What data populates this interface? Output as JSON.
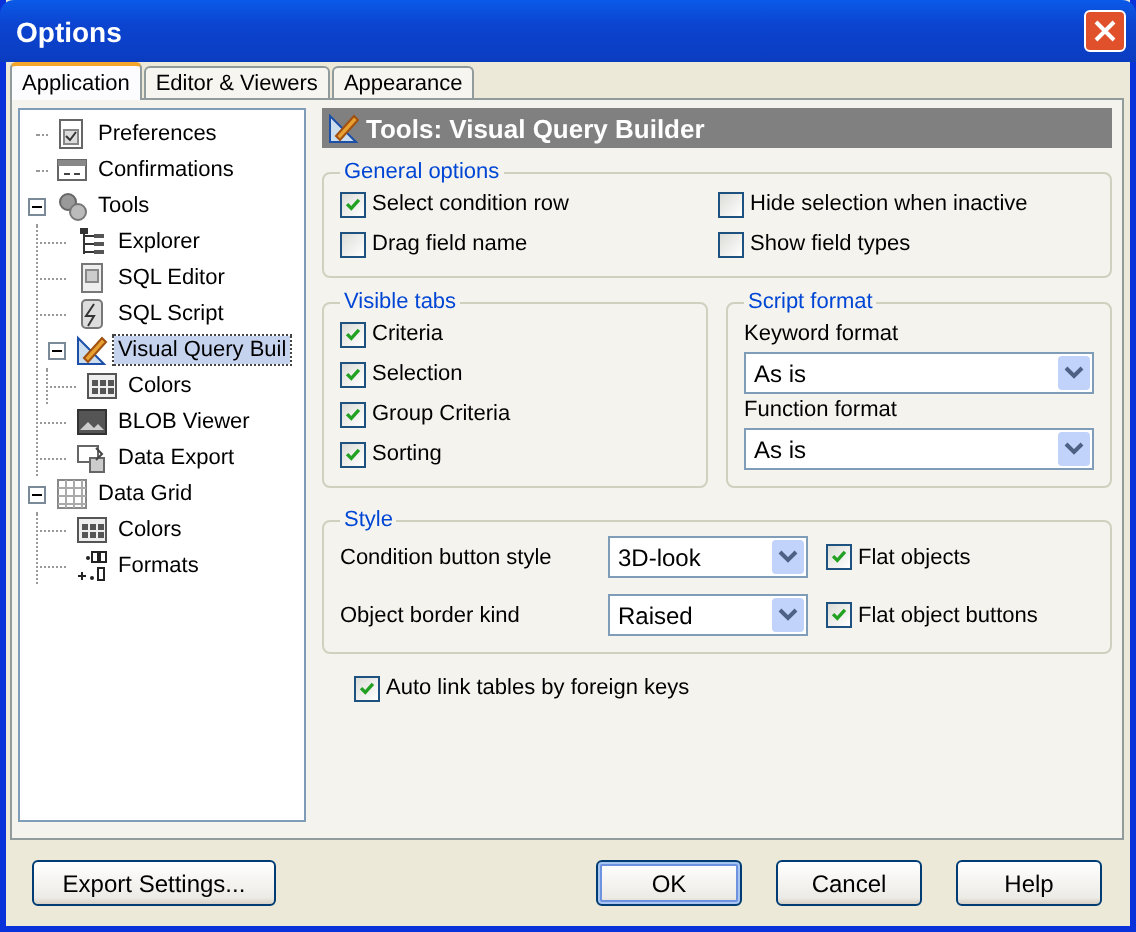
{
  "window": {
    "title": "Options"
  },
  "tabs": [
    {
      "label": "Application",
      "selected": true
    },
    {
      "label": "Editor & Viewers",
      "selected": false
    },
    {
      "label": "Appearance",
      "selected": false
    }
  ],
  "tree": [
    {
      "label": "Preferences",
      "selected": false
    },
    {
      "label": "Confirmations",
      "selected": false
    },
    {
      "label": "Tools",
      "selected": false,
      "expanded": true,
      "children": [
        {
          "label": "Explorer",
          "selected": false
        },
        {
          "label": "SQL Editor",
          "selected": false
        },
        {
          "label": "SQL Script",
          "selected": false
        },
        {
          "label": "Visual Query Buil",
          "selected": true,
          "expanded": true,
          "children": [
            {
              "label": "Colors",
              "selected": false
            }
          ]
        },
        {
          "label": "BLOB Viewer",
          "selected": false
        },
        {
          "label": "Data Export",
          "selected": false
        }
      ]
    },
    {
      "label": "Data Grid",
      "selected": false,
      "expanded": true,
      "children": [
        {
          "label": "Colors",
          "selected": false
        },
        {
          "label": "Formats",
          "selected": false
        }
      ]
    }
  ],
  "panel": {
    "title": "Tools: Visual Query Builder",
    "general_options": {
      "title": "General options",
      "checkboxes": [
        {
          "label": "Select condition row",
          "checked": true
        },
        {
          "label": "Hide selection when inactive",
          "checked": false
        },
        {
          "label": "Drag field name",
          "checked": false
        },
        {
          "label": "Show field types",
          "checked": false
        }
      ]
    },
    "visible_tabs": {
      "title": "Visible tabs",
      "checkboxes": [
        {
          "label": "Criteria",
          "checked": true
        },
        {
          "label": "Selection",
          "checked": true
        },
        {
          "label": "Group Criteria",
          "checked": true
        },
        {
          "label": "Sorting",
          "checked": true
        }
      ]
    },
    "script_format": {
      "title": "Script format",
      "fields": [
        {
          "label": "Keyword format",
          "value": "As is"
        },
        {
          "label": "Function format",
          "value": "As is"
        }
      ]
    },
    "style": {
      "title": "Style",
      "selects": [
        {
          "label": "Condition button style",
          "value": "3D-look"
        },
        {
          "label": "Object border kind",
          "value": "Raised"
        }
      ],
      "checkboxes": [
        {
          "label": "Flat objects",
          "checked": true
        },
        {
          "label": "Flat object buttons",
          "checked": true
        }
      ]
    },
    "auto_link": {
      "label": "Auto link tables by foreign keys",
      "checked": true
    }
  },
  "buttons": [
    {
      "label": "Export Settings...",
      "default": false
    },
    {
      "label": "OK",
      "default": true
    },
    {
      "label": "Cancel",
      "default": false
    },
    {
      "label": "Help",
      "default": false
    }
  ]
}
